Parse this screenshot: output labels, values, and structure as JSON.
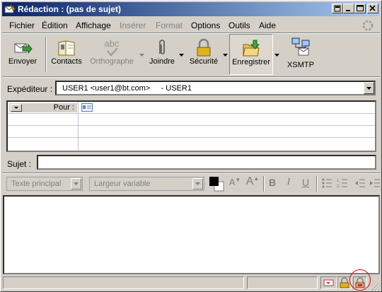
{
  "window": {
    "title": "Rédaction : (pas de sujet)"
  },
  "menu": [
    "Fichier",
    "Édition",
    "Affichage",
    "Insérer",
    "Format",
    "Options",
    "Outils",
    "Aide"
  ],
  "toolbar": {
    "send": "Envoyer",
    "contacts": "Contacts",
    "spelling": "Orthographe",
    "attach": "Joindre",
    "security": "Sécurité",
    "save": "Enregistrer",
    "xsmtp": "XSMTP",
    "spelling_icon_text": "abc"
  },
  "sender": {
    "label": "Expéditeur :",
    "value": "USER1 <user1@bt.com>     - USER1"
  },
  "recipients": {
    "type_label": "Pour :"
  },
  "subject": {
    "label": "Sujet :",
    "value": ""
  },
  "format": {
    "paragraph": "Texte principal",
    "font": "Largeur variable",
    "bold": "B",
    "italic": "I",
    "underline": "U"
  },
  "colors": {
    "title_start": "#0a246a",
    "title_end": "#a6caf0",
    "circle": "#dd0000"
  }
}
